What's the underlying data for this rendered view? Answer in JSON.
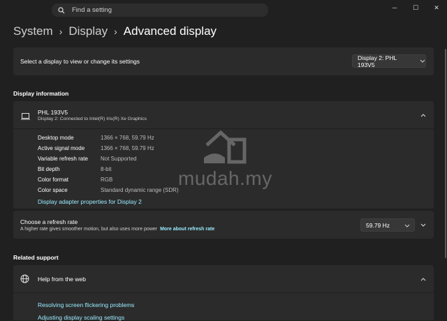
{
  "search": {
    "placeholder": "Find a setting"
  },
  "window": {
    "minimize": "─",
    "maximize": "☐",
    "close": "✕"
  },
  "breadcrumb": {
    "system": "System",
    "display": "Display",
    "current": "Advanced display",
    "sep": "›"
  },
  "display_select": {
    "label": "Select a display to view or change its settings",
    "value": "Display 2: PHL 193V5"
  },
  "display_info": {
    "heading": "Display information",
    "name": "PHL 193V5",
    "subtitle": "Display 2: Connected to Intel(R) Iris(R) Xe Graphics",
    "rows": [
      {
        "k": "Desktop mode",
        "v": "1366 × 768, 59.79 Hz"
      },
      {
        "k": "Active signal mode",
        "v": "1366 × 768, 59.79 Hz"
      },
      {
        "k": "Variable refresh rate",
        "v": "Not Supported"
      },
      {
        "k": "Bit depth",
        "v": "8-bit"
      },
      {
        "k": "Color format",
        "v": "RGB"
      },
      {
        "k": "Color space",
        "v": "Standard dynamic range (SDR)"
      }
    ],
    "adapter_link": "Display adapter properties for Display 2"
  },
  "refresh": {
    "title": "Choose a refresh rate",
    "desc": "A higher rate gives smoother motion, but also uses more power",
    "more_link": "More about refresh rate",
    "value": "59.79 Hz"
  },
  "related": {
    "heading": "Related support",
    "help_title": "Help from the web",
    "links": [
      "Resolving screen flickering problems",
      "Adjusting display scaling settings"
    ]
  },
  "watermark": {
    "text": "mudah.my"
  }
}
